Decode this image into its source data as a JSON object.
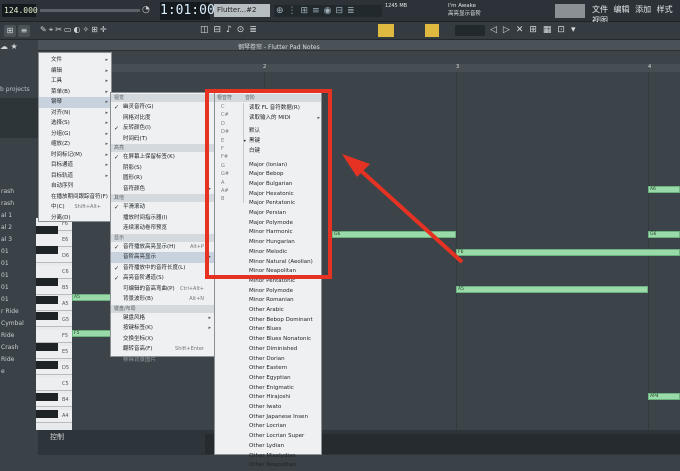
{
  "topbar": {
    "tempo": "124.000",
    "time": "1:01:00",
    "pattern": "Flutter...#2",
    "memory": "1245 MB",
    "hint_line1": "I'm Awake",
    "hint_line2": "高亮显示音阶",
    "menu": [
      "文件",
      "编辑",
      "添加",
      "样式",
      "视图"
    ]
  },
  "piano_roll": {
    "title": "钢琴卷帘 - Flutter Pad Notes",
    "ruler": [
      "2",
      "3",
      "4"
    ],
    "bottom_label": "控制"
  },
  "browser": {
    "label": "b projects",
    "items": [
      "rash",
      "rash",
      "al 1",
      "al 2",
      "al 3",
      "01",
      "01",
      "01",
      "01",
      "01",
      "r Ride",
      "Cymbal",
      "Ride",
      "Crash",
      "Ride",
      "e"
    ]
  },
  "keys": [
    "F6",
    "E6",
    "D6",
    "C6",
    "B5",
    "A5",
    "G5",
    "F5",
    "E5",
    "D5",
    "C5",
    "B4",
    "A4"
  ],
  "notes": [
    {
      "label": "A6"
    },
    {
      "label": "G6"
    },
    {
      "label": "G6"
    },
    {
      "label": "F6"
    },
    {
      "label": "A5"
    },
    {
      "label": "A5"
    },
    {
      "label": "F5"
    },
    {
      "label": "AP4"
    }
  ],
  "menu1": {
    "items": [
      "文件",
      "编辑",
      "工具",
      "菜单(B)",
      "钢琴",
      "对齐(N)",
      "选择(S)",
      "分组(G)",
      "缩放(Z)",
      "时间标记(M)",
      "目标通道",
      "目标轨道",
      "自动序列",
      "在播放期间跟踪音符(F)",
      "中(C)",
      "分离(D)"
    ],
    "shortcut": "Shift+Alt+"
  },
  "menu2": {
    "header1": "视觉",
    "items_a": [
      "幽灵音符(G)",
      "网格对比度",
      "反转颜色(I)",
      "时间码(T)"
    ],
    "header2": "高亮",
    "items_b": [
      "在屏幕上保留标签(K)",
      "阴影(S)",
      "圆形(R)",
      "音符颜色"
    ],
    "header3": "其他",
    "items_c": [
      "平滑滚动",
      "播放时间指示器(I)",
      "连续滚动卷帘预览"
    ],
    "header4": "显示",
    "items_d": [
      "音符播放高亮显示(H)",
      "音阶高亮显示",
      "音符播放中的音符长度(L)",
      "高亮音阶通道(S)",
      "可编辑的音高弯曲(P)",
      "背景波形(B)"
    ],
    "sc_d": [
      "Alt+P",
      "",
      "",
      "",
      "Ctrl+Alt+",
      "Alt+N"
    ],
    "header5": "键盘/布局",
    "items_e": [
      "键盘风格",
      "按键标签(K)"
    ],
    "items_f": [
      "交换坐标(X)",
      "翻转音高(F)",
      "移除背景图片"
    ],
    "sc_f": [
      "",
      "Shift+Enter",
      ""
    ]
  },
  "menu3": {
    "header_left": "根音符",
    "header_right": "音阶",
    "roots": [
      "C",
      "C#",
      "D",
      "D#",
      "E",
      "F",
      "F#",
      "G",
      "G#",
      "A",
      "A#",
      "B"
    ],
    "top_items": [
      "读取 FL 音符数据(R)",
      "读取输入的 MIDI"
    ],
    "mid_items": [
      "默认",
      "黑键",
      "白键"
    ],
    "scales": [
      "Major (Ionian)",
      "Major Bebop",
      "Major Bulgarian",
      "Major Hexatonic",
      "Major Pentatonic",
      "Major Persian",
      "Major Polymode",
      "Minor Harmonic",
      "Minor Hungarian",
      "Minor Melodic",
      "Minor Natural (Aeolian)",
      "Minor Neapolitan",
      "Minor Pentatonic",
      "Minor Polymode",
      "Minor Romanian",
      "Other Arabic",
      "Other Bebop Dominant",
      "Other Blues",
      "Other Blues Nonatonic",
      "Other Diminished",
      "Other Dorian",
      "Other Eastern",
      "Other Egyptian",
      "Other Enigmatic",
      "Other Hirajoshi",
      "Other Iwato",
      "Other Japanese Insen",
      "Other Locrian",
      "Other Locrian Super",
      "Other Lydian",
      "Other Mixolydian",
      "Other Neapolitan"
    ]
  },
  "colors": {
    "highlight": "#e63222",
    "note": "#9ad9a8"
  }
}
